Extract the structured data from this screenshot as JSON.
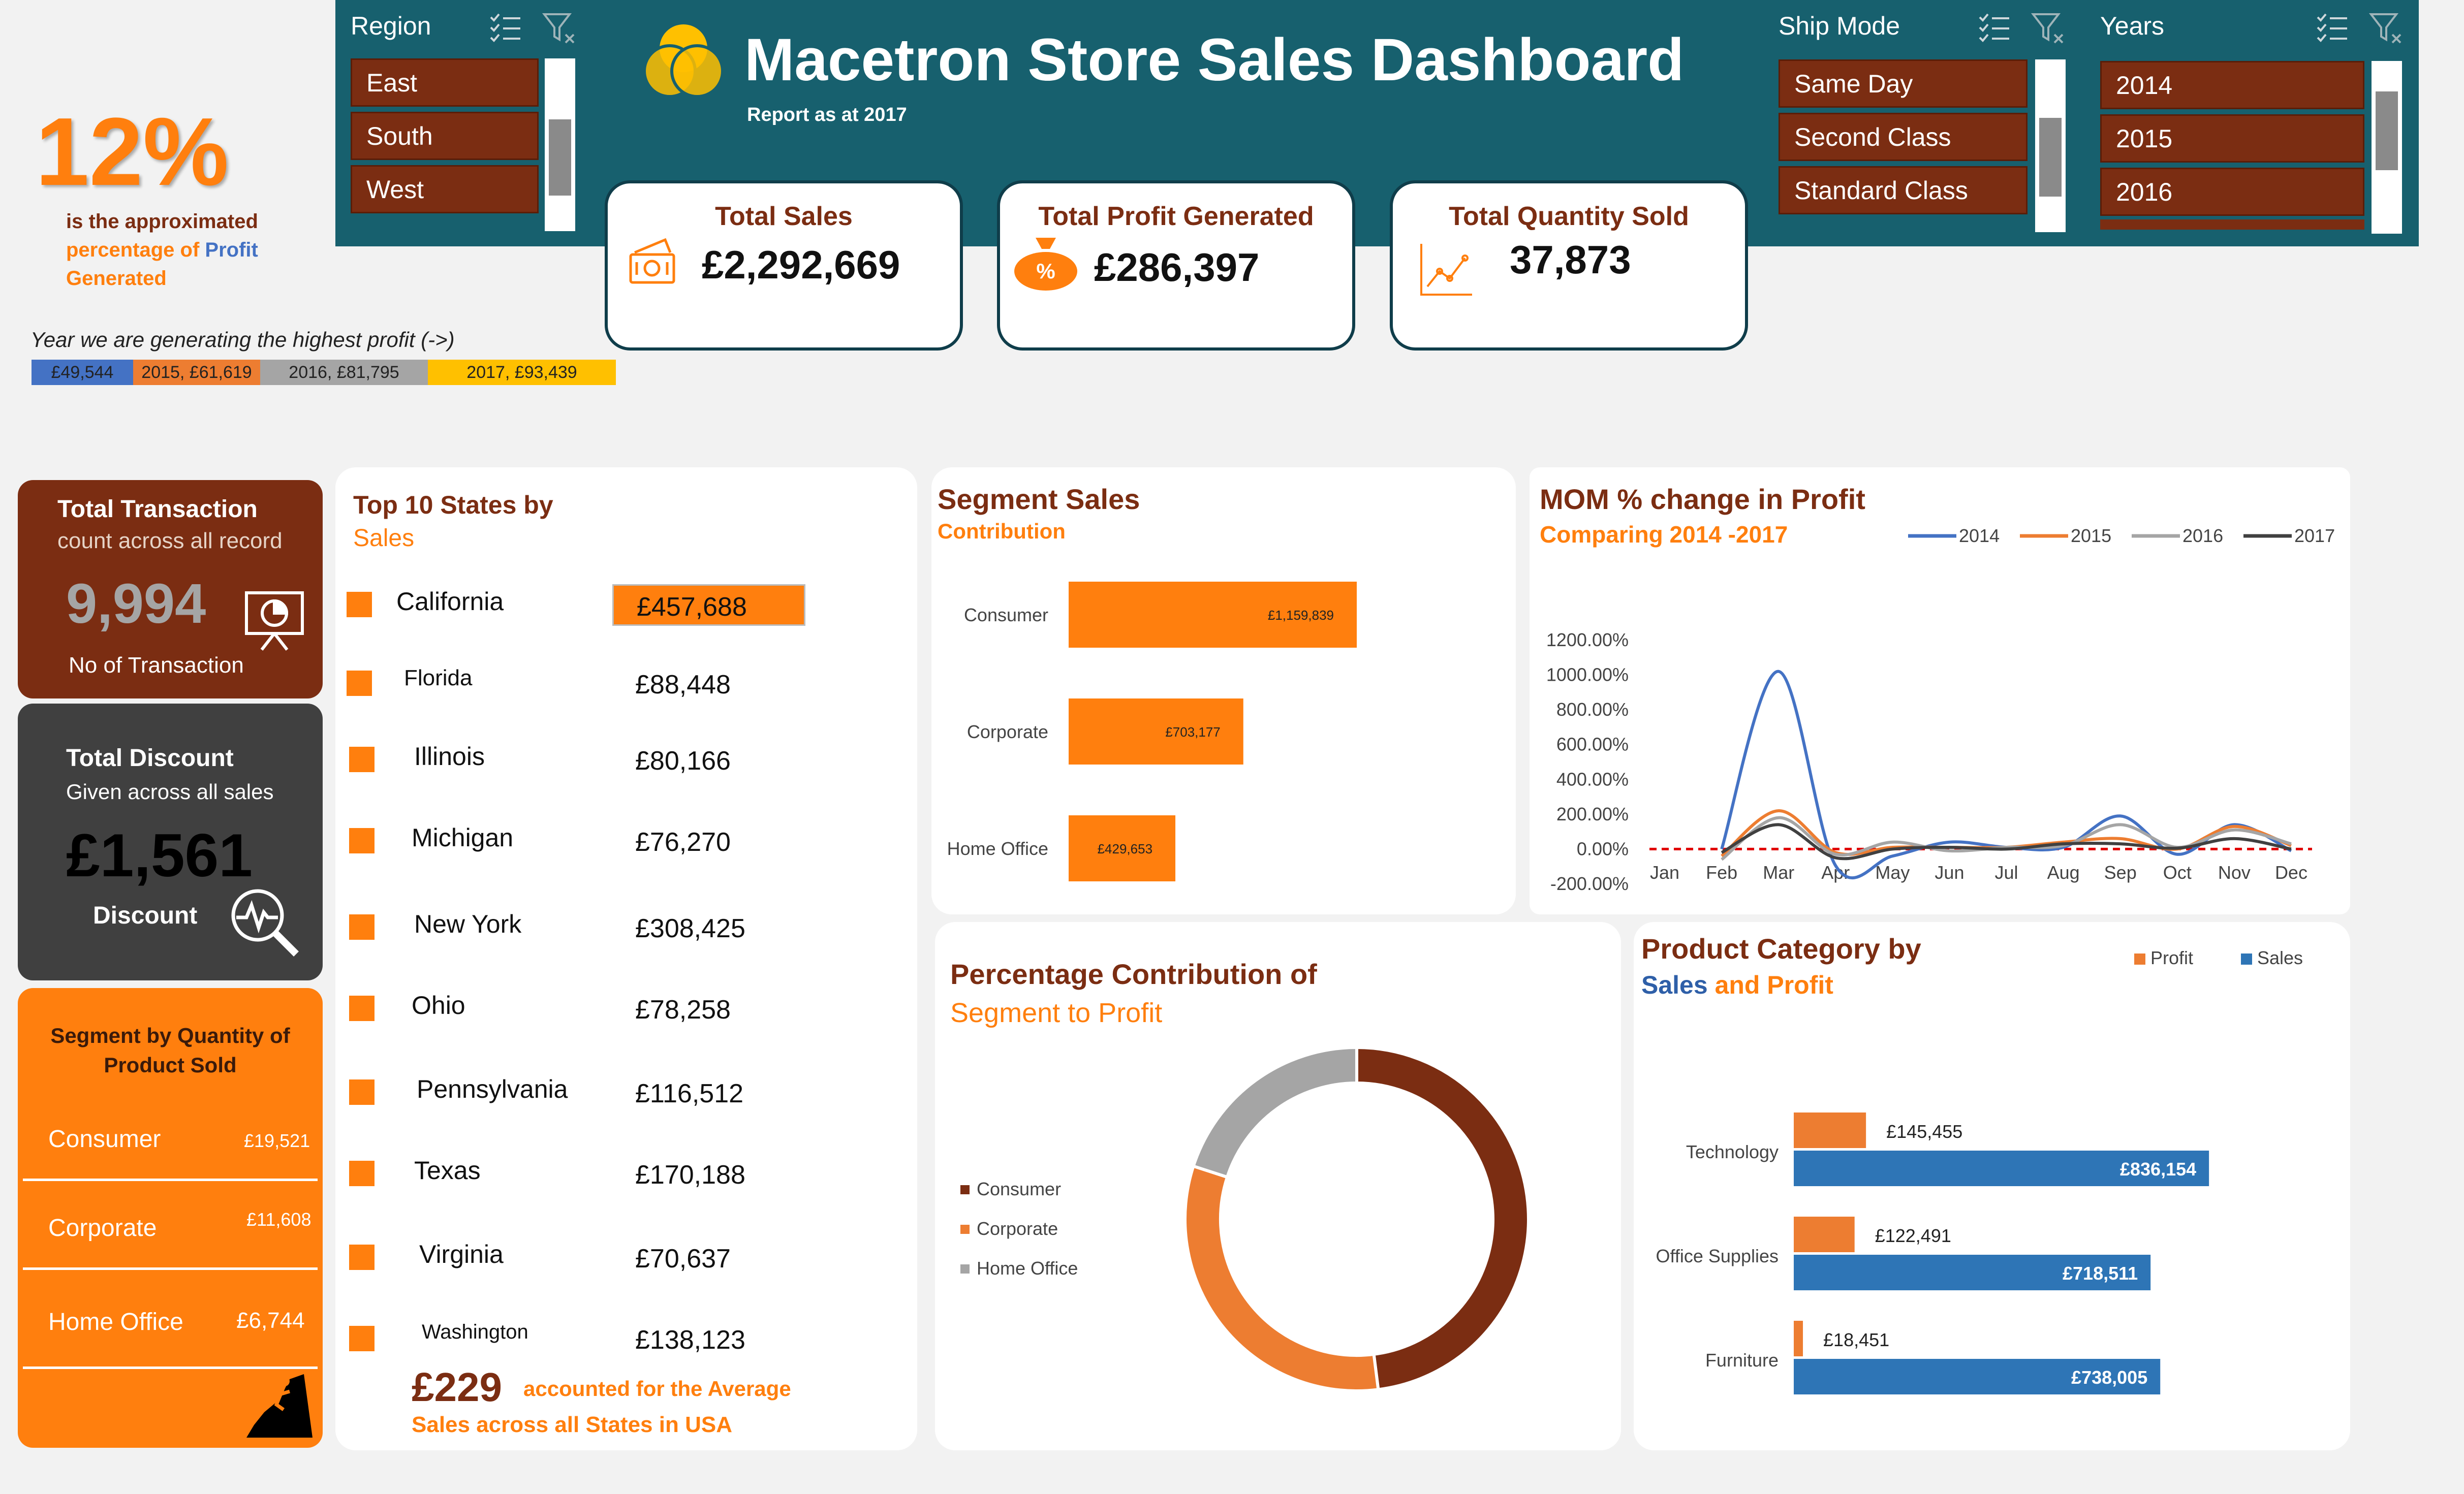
{
  "colors": {
    "teal": "#17606e",
    "brown": "#7b2d12",
    "orange": "#ff7f0e",
    "grey_dark": "#404040",
    "blue": "#2e75b6"
  },
  "profit_pct": {
    "value": "12%",
    "line1": "is the approximated",
    "line2a": "percentage of ",
    "line2b": "Profit",
    "line3": "Generated"
  },
  "year_profit": {
    "caption": "Year we are generating the highest profit (->)",
    "segments": [
      {
        "label": "£49,544",
        "color": "#4472c4"
      },
      {
        "label": "2015,  £61,619",
        "color": "#ed7d31"
      },
      {
        "label": "2016,  £81,795",
        "color": "#a5a5a5"
      },
      {
        "label": "2017,  £93,439",
        "color": "#ffc000"
      }
    ]
  },
  "region_slicer": {
    "title": "Region",
    "items": [
      "East",
      "South",
      "West"
    ]
  },
  "header": {
    "title": "Macetron Store Sales Dashboard",
    "subtitle": "Report as at 2017",
    "logo_icon": "venn-logo-icon"
  },
  "shipmode_slicer": {
    "title": "Ship Mode",
    "items": [
      "Same Day",
      "Second Class",
      "Standard Class"
    ]
  },
  "years_slicer": {
    "title": "Years",
    "items": [
      "2014",
      "2015",
      "2016"
    ]
  },
  "kpis": {
    "sales": {
      "title": "Total Sales",
      "value": "£2,292,669",
      "icon": "money-icon"
    },
    "profit": {
      "title": "Total Profit Generated",
      "value": "£286,397",
      "icon": "money-bag-icon"
    },
    "quantity": {
      "title": "Total Quantity Sold",
      "value": "37,873",
      "icon": "line-chart-icon"
    }
  },
  "transactions": {
    "title": "Total Transaction",
    "subtitle": "count across all record",
    "value": "9,994",
    "caption": "No of Transaction",
    "icon": "presentation-icon"
  },
  "discount": {
    "title": "Total Discount",
    "subtitle": "Given across all sales",
    "value": "£1,561",
    "caption": "Discount",
    "icon": "magnifier-pulse-icon"
  },
  "segment_qty": {
    "title_line1": "Segment by Quantity of",
    "title_line2": "Product Sold",
    "rows": [
      {
        "name": "Consumer",
        "value": "£19,521"
      },
      {
        "name": "Corporate",
        "value": "£11,608"
      },
      {
        "name": "Home Office",
        "value": "£6,744"
      }
    ],
    "icon": "climber-icon"
  },
  "top_states": {
    "title_line1": "Top 10 States by",
    "title_line2": "Sales",
    "rows": [
      {
        "name": "California",
        "value": "£457,688"
      },
      {
        "name": "Florida",
        "value": "£88,448"
      },
      {
        "name": "Illinois",
        "value": "£80,166"
      },
      {
        "name": "Michigan",
        "value": "£76,270"
      },
      {
        "name": "New York",
        "value": "£308,425"
      },
      {
        "name": "Ohio",
        "value": "£78,258"
      },
      {
        "name": "Pennsylvania",
        "value": "£116,512"
      },
      {
        "name": "Texas",
        "value": "£170,188"
      },
      {
        "name": "Virginia",
        "value": "£70,637"
      },
      {
        "name": "Washington",
        "value": "£138,123"
      }
    ],
    "avg_value": "£229",
    "avg_text1": "accounted for the Average",
    "avg_text2": "Sales across all States in USA"
  },
  "chart_data": [
    {
      "id": "segment_sales",
      "type": "bar",
      "title": "Segment Sales",
      "subtitle": "Contribution",
      "categories": [
        "Consumer",
        "Corporate",
        "Home Office"
      ],
      "values": [
        1159839,
        703177,
        429653
      ],
      "labels": [
        "£1,159,839",
        "£703,177",
        "£429,653"
      ],
      "color": "#ff7f0e"
    },
    {
      "id": "mom_profit",
      "type": "line",
      "title": "MOM % change in Profit",
      "subtitle": "Comparing 2014 -2017",
      "categories": [
        "Jan",
        "Feb",
        "Mar",
        "Apr",
        "May",
        "Jun",
        "Jul",
        "Aug",
        "Sep",
        "Oct",
        "Nov",
        "Dec"
      ],
      "yticks": [
        "1200.00%",
        "1000.00%",
        "800.00%",
        "600.00%",
        "400.00%",
        "200.00%",
        "0.00%",
        "-200.00%"
      ],
      "ylim": [
        -200,
        1200
      ],
      "series": [
        {
          "name": "2014",
          "color": "#4472c4",
          "values": [
            null,
            0,
            1020,
            -95,
            -40,
            40,
            10,
            10,
            190,
            -30,
            140,
            -10
          ]
        },
        {
          "name": "2015",
          "color": "#ed7d31",
          "values": [
            null,
            -40,
            220,
            -20,
            10,
            10,
            10,
            40,
            60,
            0,
            130,
            20
          ]
        },
        {
          "name": "2016",
          "color": "#a5a5a5",
          "values": [
            null,
            -60,
            180,
            -30,
            40,
            -10,
            10,
            20,
            140,
            10,
            110,
            30
          ]
        },
        {
          "name": "2017",
          "color": "#404040",
          "values": [
            null,
            -20,
            140,
            -50,
            0,
            10,
            0,
            30,
            30,
            5,
            60,
            0
          ]
        }
      ],
      "reference_line": {
        "value": 0,
        "color": "#e00000",
        "style": "dashed"
      }
    },
    {
      "id": "segment_profit",
      "type": "pie",
      "title_line1": "Percentage Contribution of",
      "title_line2": "Segment to Profit",
      "categories": [
        "Consumer",
        "Corporate",
        "Home Office"
      ],
      "values": [
        48,
        32,
        20
      ],
      "colors": [
        "#7b2d12",
        "#ed7d31",
        "#a5a5a5"
      ]
    },
    {
      "id": "category_sales_profit",
      "type": "bar",
      "title_line1": "Product Category by",
      "title_sales": "Sales",
      "title_and": " and ",
      "title_profit": "Profit",
      "categories": [
        "Technology",
        "Office Supplies",
        "Furniture"
      ],
      "series": [
        {
          "name": "Profit",
          "color": "#ed7d31",
          "values": [
            145455,
            122491,
            18451
          ],
          "labels": [
            "£145,455",
            "£122,491",
            "£18,451"
          ]
        },
        {
          "name": "Sales",
          "color": "#2e75b6",
          "values": [
            836154,
            718511,
            738005
          ],
          "labels": [
            "£836,154",
            "£718,511",
            "£738,005"
          ]
        }
      ]
    }
  ]
}
